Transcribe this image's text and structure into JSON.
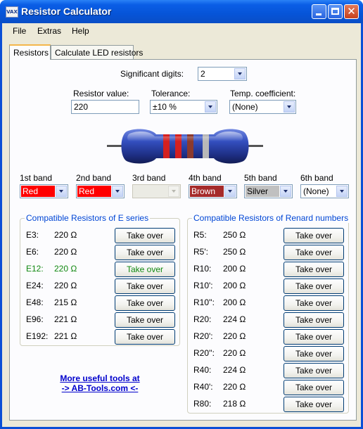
{
  "window": {
    "title": "Resistor Calculator",
    "icon": "resistor-app-icon",
    "icon_text": "VAX"
  },
  "menu": [
    "File",
    "Extras",
    "Help"
  ],
  "tabs": [
    {
      "label": "Resistors",
      "active": true
    },
    {
      "label": "Calculate LED resistors",
      "active": false
    }
  ],
  "form": {
    "significant_digits_label": "Significant digits:",
    "significant_digits_value": "2",
    "resistor_value_label": "Resistor value:",
    "resistor_value": "220",
    "tolerance_label": "Tolerance:",
    "tolerance_value": "±10 %",
    "temp_coeff_label": "Temp. coefficient:",
    "temp_coeff_value": "(None)"
  },
  "bands": [
    {
      "label": "1st band",
      "value": "Red",
      "color": "#ff0000",
      "text_color": "#ffffff"
    },
    {
      "label": "2nd band",
      "value": "Red",
      "color": "#ff0000",
      "text_color": "#ffffff"
    },
    {
      "label": "3rd band",
      "value": "",
      "color": "#ebebe4",
      "text_color": "#000000",
      "disabled": true
    },
    {
      "label": "4th band",
      "value": "Brown",
      "color": "#a52a2a",
      "text_color": "#ffffff"
    },
    {
      "label": "5th band",
      "value": "Silver",
      "color": "#c0c0c0",
      "text_color": "#000000"
    },
    {
      "label": "6th band",
      "value": "(None)",
      "color": "#ffffff",
      "text_color": "#000000"
    }
  ],
  "resistor_colors": {
    "body": "#2a3d9a",
    "band1": "#d42020",
    "band2": "#d42020",
    "band3": "#8b3a2e",
    "band4": "#b8b8b8"
  },
  "e_series": {
    "title": "Compatible Resistors of E series",
    "button_label": "Take over",
    "rows": [
      {
        "name": "E3:",
        "value": "220 Ω",
        "highlight": false
      },
      {
        "name": "E6:",
        "value": "220 Ω",
        "highlight": false
      },
      {
        "name": "E12:",
        "value": "220 Ω",
        "highlight": true
      },
      {
        "name": "E24:",
        "value": "220 Ω",
        "highlight": false
      },
      {
        "name": "E48:",
        "value": "215 Ω",
        "highlight": false
      },
      {
        "name": "E96:",
        "value": "221 Ω",
        "highlight": false
      },
      {
        "name": "E192:",
        "value": "221 Ω",
        "highlight": false
      }
    ]
  },
  "renard": {
    "title": "Compatible Resistors of Renard numbers",
    "button_label": "Take over",
    "rows": [
      {
        "name": "R5:",
        "value": "250 Ω"
      },
      {
        "name": "R5':",
        "value": "250 Ω"
      },
      {
        "name": "R10:",
        "value": "200 Ω"
      },
      {
        "name": "R10':",
        "value": "200 Ω"
      },
      {
        "name": "R10'':",
        "value": "200 Ω"
      },
      {
        "name": "R20:",
        "value": "224 Ω"
      },
      {
        "name": "R20':",
        "value": "220 Ω"
      },
      {
        "name": "R20'':",
        "value": "220 Ω"
      },
      {
        "name": "R40:",
        "value": "224 Ω"
      },
      {
        "name": "R40':",
        "value": "220 Ω"
      },
      {
        "name": "R80:",
        "value": "218 Ω"
      }
    ]
  },
  "link": {
    "line1": "More useful tools at",
    "line2": "-> AB-Tools.com <-"
  }
}
